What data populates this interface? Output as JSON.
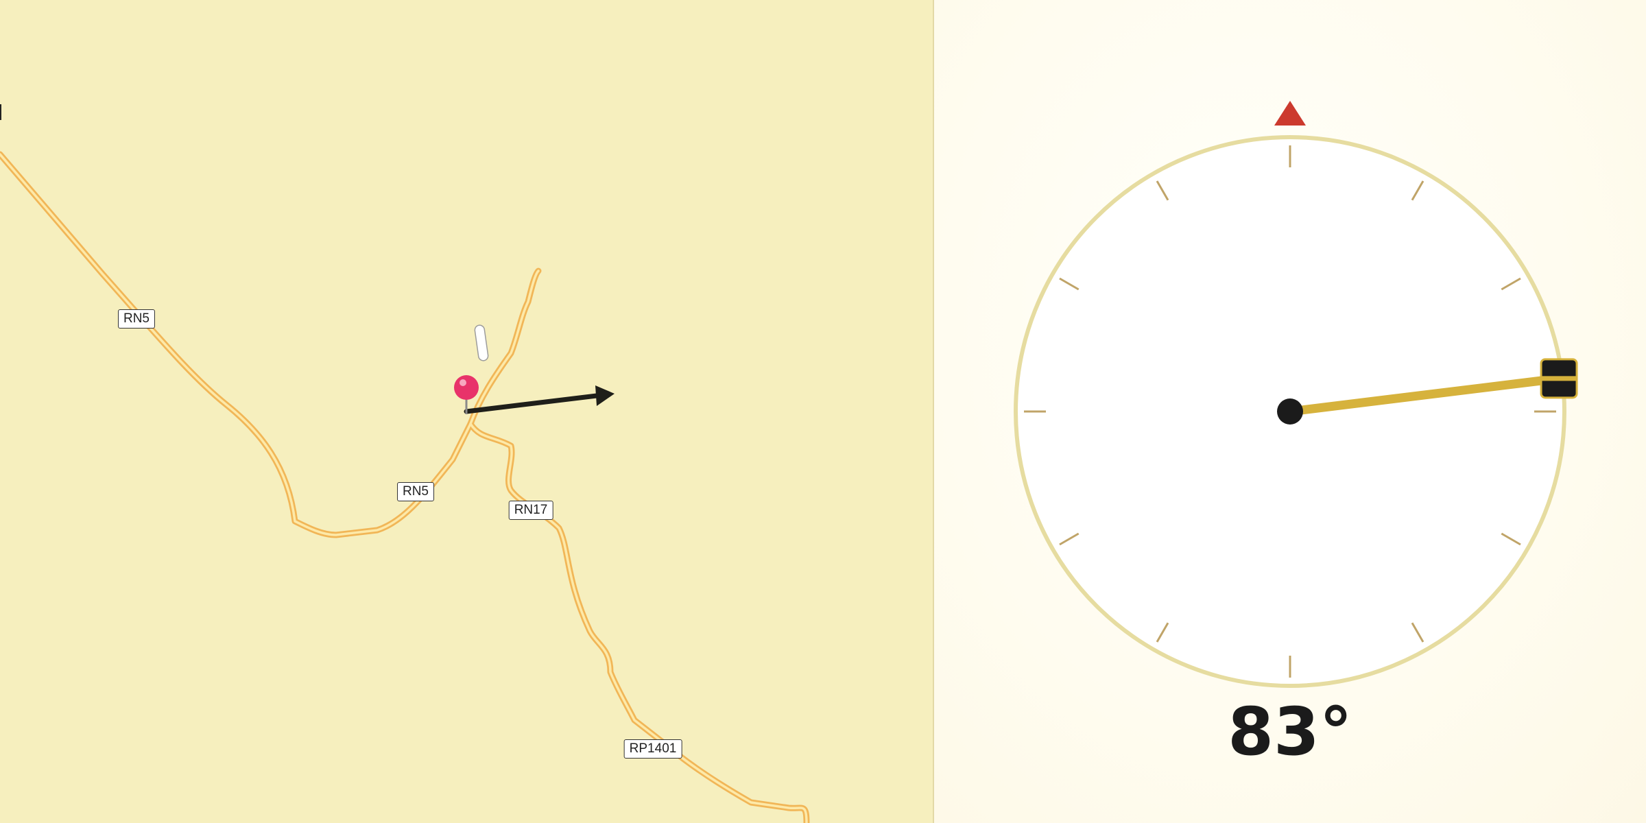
{
  "map": {
    "road_labels": [
      {
        "id": "rn5-north",
        "text": "RN5"
      },
      {
        "id": "rn5-south",
        "text": "RN5"
      },
      {
        "id": "rn17",
        "text": "RN17"
      },
      {
        "id": "rp1401",
        "text": "RP1401"
      }
    ],
    "colors": {
      "land": "#f6efbe",
      "road_casing": "#f1b657",
      "road_fill": "#fde9a8",
      "pin": "#e8336a",
      "arrow": "#1f1f1a"
    }
  },
  "compass": {
    "heading_degrees": 83,
    "bearing_text": "83°",
    "north_marker_icon": "north-triangle-icon",
    "colors": {
      "dial_face": "#ffffff",
      "dial_ring": "#e6dca0",
      "ticks": "#c0a468",
      "needle": "#d6b23c",
      "north_marker": "#cc3a2e",
      "hub": "#1b1b1b"
    }
  }
}
